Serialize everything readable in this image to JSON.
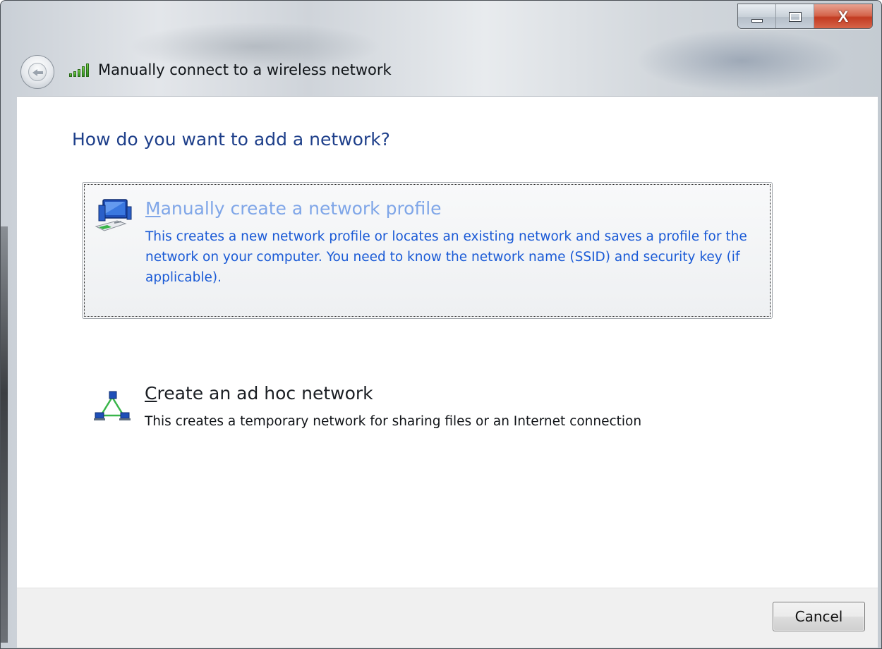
{
  "window": {
    "title": "Manually connect to a wireless network",
    "buttons": {
      "minimize_icon": "minimize-icon",
      "maximize_icon": "maximize-icon",
      "close_icon": "close-icon",
      "close_glyph": "X"
    }
  },
  "nav": {
    "back_icon": "back-arrow-icon",
    "network_icon": "wireless-signal-icon"
  },
  "main": {
    "heading": "How do you want to add a network?",
    "options": [
      {
        "accelerator": "M",
        "title_rest": "anually create a network profile",
        "description": "This creates a new network profile or locates an existing network and saves a profile for the network on your computer. You need to know the network name (SSID) and security key (if applicable).",
        "icon": "network-profile-icon",
        "state": "selected"
      },
      {
        "accelerator": "C",
        "title_rest": "reate an ad hoc network",
        "description": "This creates a temporary network for sharing files or an Internet connection",
        "icon": "ad-hoc-network-icon",
        "state": "normal"
      }
    ]
  },
  "footer": {
    "cancel_label": "Cancel"
  },
  "colors": {
    "heading": "#1e3f8a",
    "link_hover_title": "#7fa6e8",
    "link_hover_text": "#1a5ad6",
    "close_button": "#c23b22"
  }
}
